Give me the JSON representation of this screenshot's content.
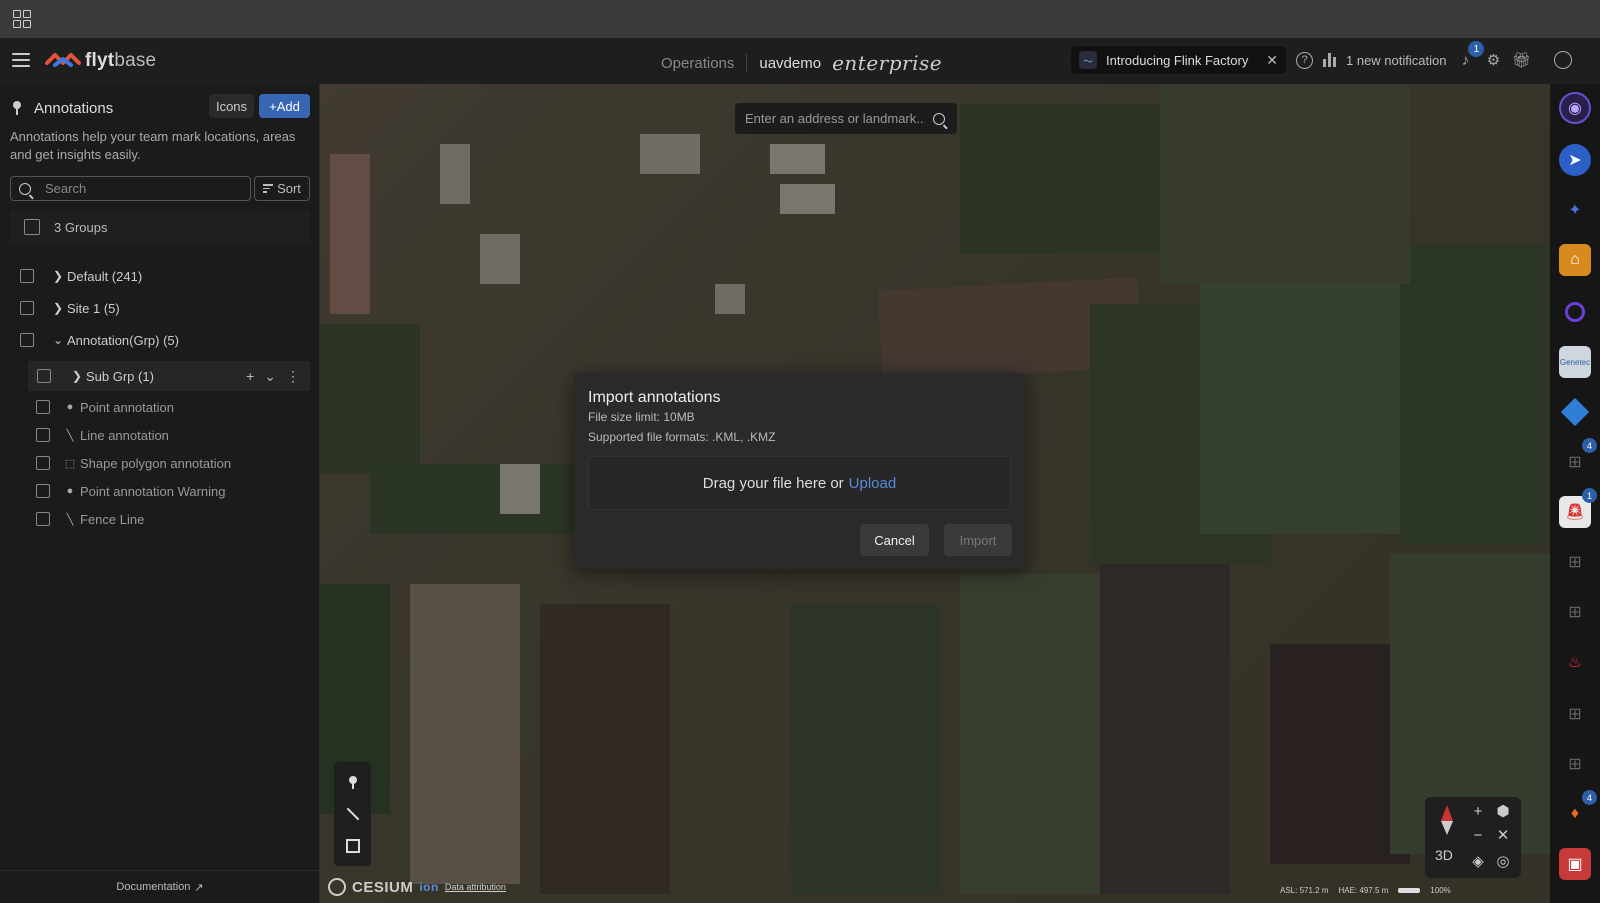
{
  "header": {
    "logo_text_bold": "flyt",
    "logo_text": "base",
    "nav_operations": "Operations",
    "org": "uavdemo",
    "edition": "enterprise",
    "promo_text": "Introducing Flink Factory",
    "promo_close": "✕",
    "notification_text": "1 new notification",
    "notification_count": "1",
    "help": "?"
  },
  "sidebar": {
    "title": "Annotations",
    "icons_button": "Icons",
    "add_button": "+Add",
    "description": "Annotations help your team mark locations, areas and get insights easily.",
    "search_placeholder": "Search",
    "sort_label": "Sort",
    "groups_label": "3 Groups",
    "groups": [
      {
        "label": "Default (241)",
        "chevron": "❯"
      },
      {
        "label": "Site 1 (5)",
        "chevron": "❯"
      },
      {
        "label": "Annotation(Grp) (5)",
        "chevron": "⌄"
      }
    ],
    "subgroup": {
      "label": "Sub Grp (1)",
      "chevron": "❯",
      "add": "+",
      "collapse": "⌄",
      "more": "⋮"
    },
    "items": [
      {
        "label": "Point annotation",
        "icon": "pin"
      },
      {
        "label": "Line annotation",
        "icon": "line"
      },
      {
        "label": "Shape polygon annotation",
        "icon": "polygon"
      },
      {
        "label": "Point annotation Warning",
        "icon": "pin"
      },
      {
        "label": "Fence Line",
        "icon": "line"
      }
    ],
    "footer_link": "Documentation"
  },
  "map": {
    "search_placeholder": "Enter an address or landmark...",
    "attribution": "CESIUM",
    "attribution_ion": "ion",
    "attribution_link": "Data attribution",
    "view_mode": "3D",
    "asl_label": "ASL:",
    "asl_value": "571.2 m",
    "hae_label": "HAE:",
    "hae_value": "497.5 m",
    "zoom_percent": "100%"
  },
  "rail": {
    "apps": [
      {
        "name": "app-profile",
        "badge": ""
      },
      {
        "name": "app-navigation",
        "badge": ""
      },
      {
        "name": "app-dna",
        "badge": ""
      },
      {
        "name": "app-layers",
        "badge": ""
      },
      {
        "name": "app-ring",
        "badge": ""
      },
      {
        "name": "app-genetec",
        "badge": "",
        "text": "Genetec"
      },
      {
        "name": "app-diamond",
        "badge": ""
      },
      {
        "name": "app-widget-1",
        "badge": "4"
      },
      {
        "name": "app-alarm",
        "badge": "1"
      },
      {
        "name": "app-widget-2",
        "badge": ""
      },
      {
        "name": "app-widget-3",
        "badge": ""
      },
      {
        "name": "app-siren",
        "badge": ""
      },
      {
        "name": "app-widget-4",
        "badge": ""
      },
      {
        "name": "app-widget-5",
        "badge": ""
      },
      {
        "name": "app-fire",
        "badge": "4"
      },
      {
        "name": "app-camera",
        "badge": ""
      }
    ]
  },
  "modal": {
    "title": "Import annotations",
    "size_limit": "File size limit: 10MB",
    "formats": "Supported file formats: .KML, .KMZ",
    "drop_text": "Drag your file here or",
    "upload_link": "Upload",
    "cancel": "Cancel",
    "import": "Import"
  },
  "colors": {
    "accent": "#3767b3",
    "link": "#5b8ad8",
    "badge": "#2d5fa8"
  }
}
